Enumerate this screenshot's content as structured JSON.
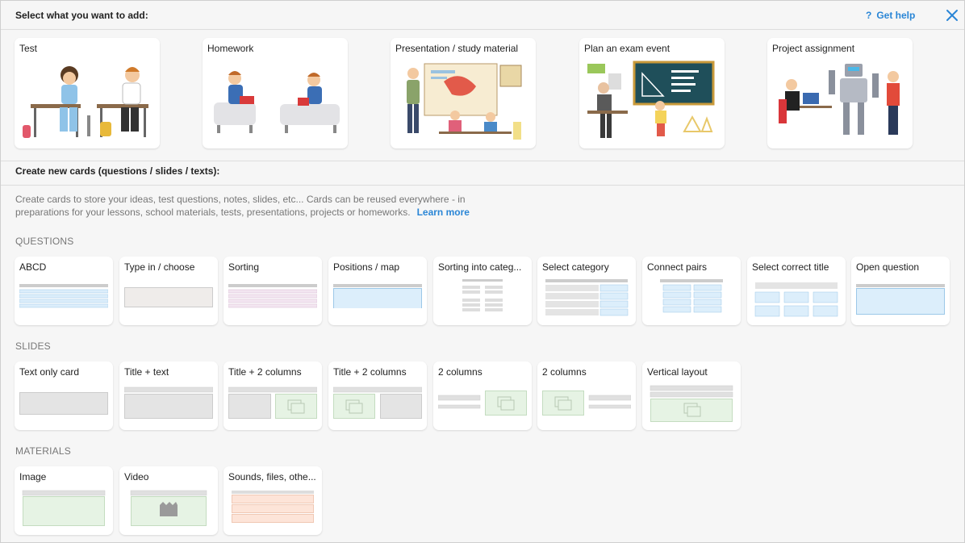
{
  "header": {
    "title": "Select what you want to add:",
    "help_q": "?",
    "help_label": "Get help"
  },
  "top_cards": [
    {
      "label": "Test"
    },
    {
      "label": "Homework"
    },
    {
      "label": "Presentation / study material"
    },
    {
      "label": "Plan an exam event"
    },
    {
      "label": "Project assignment"
    }
  ],
  "create": {
    "title": "Create new cards (questions / slides / texts):",
    "description": "Create cards to store your ideas, test questions, notes, slides, etc... Cards can be reused everywhere - in preparations for your lessons, school materials, tests, presentations, projects or homeworks.",
    "learn_more": "Learn more"
  },
  "questions": {
    "label": "QUESTIONS",
    "items": [
      {
        "label": "ABCD"
      },
      {
        "label": "Type in / choose"
      },
      {
        "label": "Sorting"
      },
      {
        "label": "Positions / map"
      },
      {
        "label": "Sorting into categ..."
      },
      {
        "label": "Select category"
      },
      {
        "label": "Connect pairs"
      },
      {
        "label": "Select correct title"
      },
      {
        "label": "Open question"
      }
    ]
  },
  "slides": {
    "label": "SLIDES",
    "items": [
      {
        "label": "Text only card"
      },
      {
        "label": "Title + text"
      },
      {
        "label": "Title + 2 columns"
      },
      {
        "label": "Title + 2 columns"
      },
      {
        "label": "2 columns"
      },
      {
        "label": "2 columns"
      },
      {
        "label": "Vertical layout"
      }
    ]
  },
  "materials": {
    "label": "MATERIALS",
    "items": [
      {
        "label": "Image"
      },
      {
        "label": "Video"
      },
      {
        "label": "Sounds, files, othe..."
      }
    ]
  },
  "colors": {
    "accent": "#2a86d6",
    "blue_fill": "#dceefb",
    "green_fill": "#e6f3e4",
    "pink_fill": "#fde4d8",
    "gray_fill": "#e4e4e4"
  }
}
